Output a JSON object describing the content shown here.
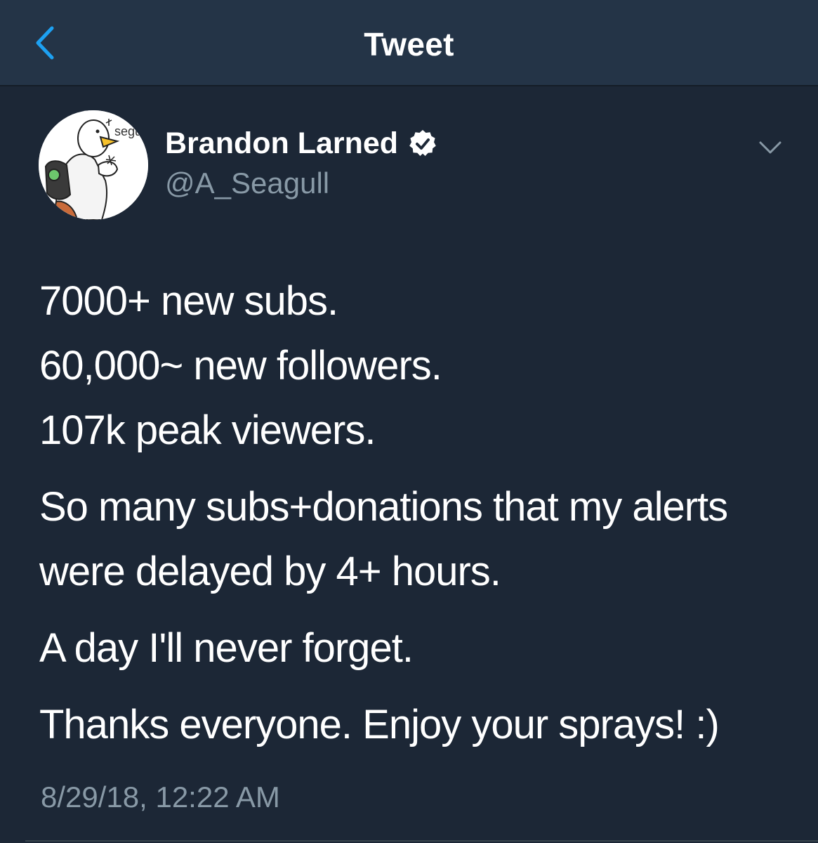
{
  "header": {
    "title": "Tweet",
    "back_icon": "chevron-left-icon"
  },
  "author": {
    "name": "Brandon Larned",
    "handle": "@A_Seagull",
    "verified": true,
    "avatar_text": "segu"
  },
  "tweet": {
    "lines": [
      "7000+ new subs.",
      "60,000~ new followers.",
      "107k peak viewers.",
      "So many subs+donations that my alerts",
      "were delayed by 4+ hours.",
      "A day I'll never forget.",
      "Thanks everyone. Enjoy your sprays! :)"
    ],
    "timestamp": "8/29/18, 12:22 AM"
  },
  "colors": {
    "background": "#1c2736",
    "navbar": "#243447",
    "accent": "#1da1f2",
    "secondary_text": "#8899a6"
  }
}
